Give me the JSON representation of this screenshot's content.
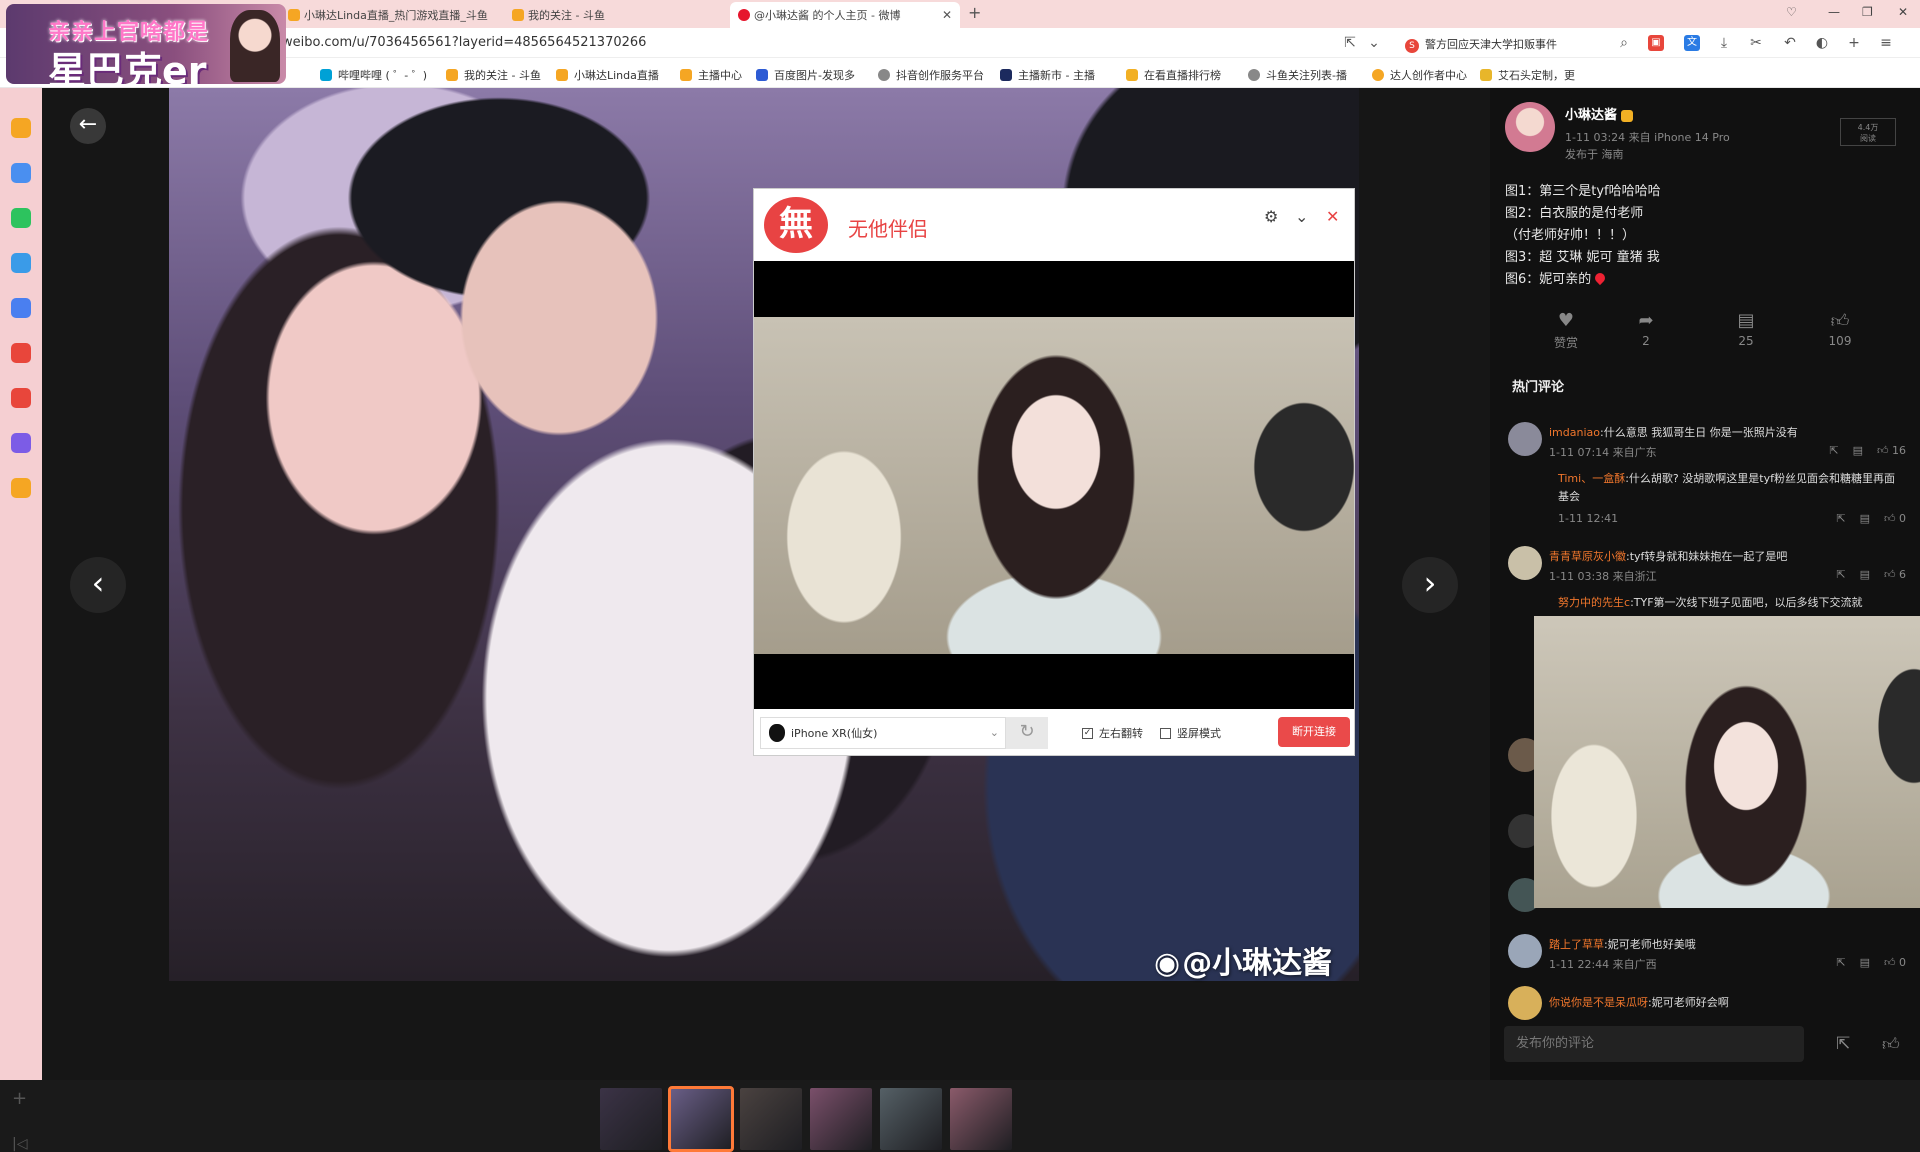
{
  "browser": {
    "tabs": [
      {
        "label": "小琳达Linda直播_热门游戏直播_斗鱼"
      },
      {
        "label": "我的关注 - 斗鱼"
      },
      {
        "label": "@小琳达酱 的个人主页 - 微博"
      }
    ],
    "url": "weibo.com/u/7036456561?layerid=4856564521370266",
    "hot_search": "警方回应天津大学扣贩事件",
    "bookmarks": [
      "哔哩哔哩 ( ゜- ゜)",
      "我的关注 - 斗鱼",
      "小琳达Linda直播",
      "主播中心",
      "百度图片-发现多",
      "抖音创作服务平台",
      "主播新市 - 主播",
      "在看直播排行榜",
      "斗鱼关注列表-播",
      "达人创作者中心",
      "艾石头定制，更"
    ]
  },
  "overlay_logo": {
    "top": "亲亲上官啥都是",
    "big": "星巴克er"
  },
  "viewer": {
    "watermark": "@小琳达酱",
    "thumb_count": 6,
    "selected_thumb": 2
  },
  "dialog": {
    "logo_char": "無",
    "title": "无他伴侣",
    "device": "iPhone XR(仙女)",
    "mirror_label": "左右翻转",
    "mirror_checked": true,
    "landscape_label": "竖屏模式",
    "landscape_checked": false,
    "disconnect": "断开连接"
  },
  "post": {
    "author": "小琳达酱",
    "meta": "1-11 03:24  来自 iPhone 14 Pro",
    "location": "发布于 海南",
    "reads": "4.4万",
    "reads_label": "阅读",
    "lines": [
      "图1：第三个是tyf哈哈哈哈",
      "图2：白衣服的是付老师",
      "（付老师好帅！！！）",
      "图3：超 艾琳 妮可 童猪 我",
      "图6：妮可亲的"
    ],
    "actions": {
      "reward": "赞赏",
      "share": "2",
      "comment": "25",
      "like": "109"
    }
  },
  "comments_title": "热门评论",
  "comments": [
    {
      "name": "imdaniao",
      "text": ":什么意思 我狐哥生日 你是一张照片没有",
      "meta": "1-11 07:14 来自广东",
      "likes": "16",
      "reply": {
        "name": "Timi、一盒酥",
        "text": ":什么胡歌? 没胡歌啊这里是tyf粉丝见面会和糖糖里再面基会",
        "meta": "1-11 12:41",
        "likes": "0"
      }
    },
    {
      "name": "青青草原灰小徽",
      "text": ":tyf转身就和妹妹抱在一起了是吧",
      "meta": "1-11 03:38 来自浙江",
      "likes": "6",
      "reply": {
        "name": "努力中的先生c",
        "text": ":TYF第一次线下班子见面吧，以后多线下交流就"
      }
    },
    {
      "name": "踏上了草草",
      "text": ":妮可老师也好美哦",
      "meta": "1-11 22:44 来自广西",
      "likes": "0"
    },
    {
      "name": "你说你是不是呆瓜呀",
      "text": ":妮可老师好会啊"
    }
  ],
  "comment_placeholder": "发布你的评论"
}
